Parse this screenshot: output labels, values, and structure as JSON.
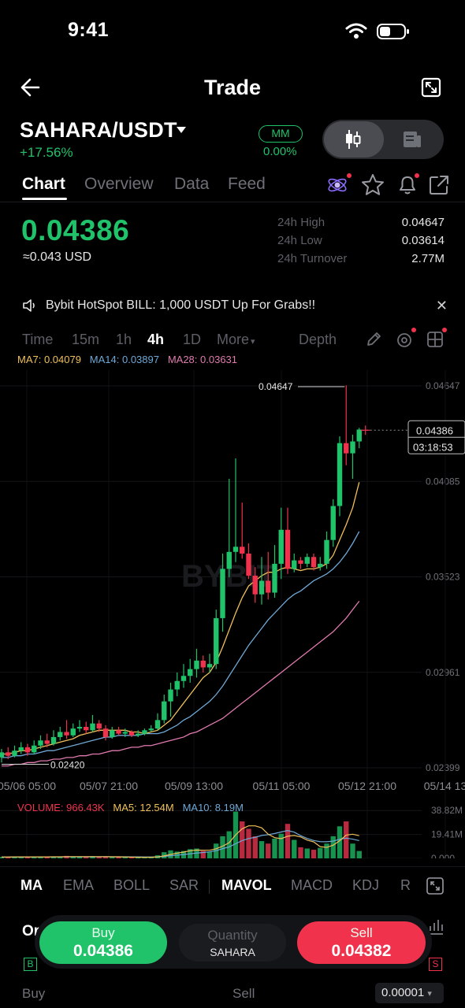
{
  "status_bar": {
    "time": "9:41"
  },
  "header": {
    "title": "Trade"
  },
  "pair": {
    "symbol": "SAHARA/USDT",
    "change": "+17.56%",
    "mm_label": "MM",
    "mm_value": "0.00%"
  },
  "tabs": [
    "Chart",
    "Overview",
    "Data",
    "Feed"
  ],
  "ticker": {
    "last_price": "0.04386",
    "usd_value": "≈0.043 USD",
    "stats": [
      {
        "label": "24h High",
        "value": "0.04647"
      },
      {
        "label": "24h Low",
        "value": "0.03614"
      },
      {
        "label": "24h Turnover",
        "value": "2.77M"
      }
    ]
  },
  "announcement": "Bybit HotSpot BILL: 1,000 USDT Up For Grabs!!",
  "intervals": {
    "items": [
      "Time",
      "15m",
      "1h",
      "4h",
      "1D"
    ],
    "active": "4h",
    "more": "More",
    "depth": "Depth"
  },
  "ma_legend": {
    "ma7": "MA7: 0.04079",
    "ma14": "MA14: 0.03897",
    "ma28": "MA28: 0.03631"
  },
  "colors": {
    "up": "#20c26a",
    "down": "#f0324d",
    "ma7": "#f0c05a",
    "ma14": "#6fa8d6",
    "ma28": "#e07ab0",
    "accent_star": "#9b6cff"
  },
  "chart_data": {
    "type": "candlestick",
    "x_tick_labels": [
      "05/06 05:00",
      "05/07 21:00",
      "05/09 13:00",
      "05/11 05:00",
      "05/12 21:00",
      "05/14 13"
    ],
    "y_tick_labels": [
      "0.04647",
      "0.04085",
      "0.03523",
      "0.02961",
      "0.02399"
    ],
    "ylim": [
      0.02399,
      0.04647
    ],
    "high_marker": "0.04647",
    "low_marker": "0.02420",
    "last_price_tag": "0.04386",
    "countdown": "03:18:53",
    "watermark": "BYBIT",
    "candles": [
      [
        0.0246,
        0.0249,
        0.0243,
        0.0251
      ],
      [
        0.0249,
        0.0247,
        0.0245,
        0.0252
      ],
      [
        0.0247,
        0.025,
        0.0246,
        0.0253
      ],
      [
        0.025,
        0.0252,
        0.0248,
        0.0255
      ],
      [
        0.0252,
        0.0249,
        0.0247,
        0.0254
      ],
      [
        0.0249,
        0.0253,
        0.0248,
        0.0256
      ],
      [
        0.0253,
        0.0256,
        0.0251,
        0.0259
      ],
      [
        0.0256,
        0.0254,
        0.0252,
        0.026
      ],
      [
        0.0254,
        0.0258,
        0.0253,
        0.0262
      ],
      [
        0.0258,
        0.0261,
        0.0256,
        0.0264
      ],
      [
        0.0261,
        0.0259,
        0.0257,
        0.0268
      ],
      [
        0.0259,
        0.0263,
        0.0258,
        0.0266
      ],
      [
        0.0263,
        0.0264,
        0.0261,
        0.0268
      ],
      [
        0.0264,
        0.0262,
        0.026,
        0.0267
      ],
      [
        0.0262,
        0.0266,
        0.0261,
        0.0271
      ],
      [
        0.0266,
        0.0263,
        0.0261,
        0.0268
      ],
      [
        0.0263,
        0.0258,
        0.0256,
        0.0265
      ],
      [
        0.0258,
        0.0262,
        0.0257,
        0.0264
      ],
      [
        0.0262,
        0.026,
        0.0259,
        0.0264
      ],
      [
        0.026,
        0.0261,
        0.0258,
        0.0263
      ],
      [
        0.0261,
        0.0259,
        0.0258,
        0.0262
      ],
      [
        0.0259,
        0.026,
        0.0258,
        0.0262
      ],
      [
        0.026,
        0.0262,
        0.0259,
        0.0263
      ],
      [
        0.0262,
        0.0263,
        0.0261,
        0.0265
      ],
      [
        0.0263,
        0.0268,
        0.0262,
        0.0272
      ],
      [
        0.0268,
        0.0279,
        0.0266,
        0.0283
      ],
      [
        0.0279,
        0.0286,
        0.027,
        0.029
      ],
      [
        0.0286,
        0.0291,
        0.0282,
        0.0296
      ],
      [
        0.0291,
        0.0294,
        0.0287,
        0.0301
      ],
      [
        0.0294,
        0.0298,
        0.029,
        0.0304
      ],
      [
        0.0298,
        0.0303,
        0.0293,
        0.031
      ],
      [
        0.0303,
        0.0299,
        0.0296,
        0.0306
      ],
      [
        0.0299,
        0.0301,
        0.0296,
        0.0307
      ],
      [
        0.0301,
        0.0328,
        0.0298,
        0.0333
      ],
      [
        0.0328,
        0.0357,
        0.032,
        0.0366
      ],
      [
        0.0357,
        0.0367,
        0.0352,
        0.041
      ],
      [
        0.0367,
        0.037,
        0.0361,
        0.0422
      ],
      [
        0.037,
        0.0366,
        0.0363,
        0.0396
      ],
      [
        0.0366,
        0.0353,
        0.0351,
        0.0372
      ],
      [
        0.0353,
        0.0342,
        0.0337,
        0.0358
      ],
      [
        0.0342,
        0.035,
        0.0336,
        0.0364
      ],
      [
        0.035,
        0.0343,
        0.0339,
        0.0367
      ],
      [
        0.0343,
        0.036,
        0.034,
        0.0371
      ],
      [
        0.036,
        0.038,
        0.0351,
        0.0393
      ],
      [
        0.038,
        0.0357,
        0.0354,
        0.0393
      ],
      [
        0.0357,
        0.0362,
        0.0355,
        0.0366
      ],
      [
        0.0362,
        0.036,
        0.0357,
        0.0364
      ],
      [
        0.036,
        0.0364,
        0.0358,
        0.0366
      ],
      [
        0.0364,
        0.0358,
        0.0356,
        0.0366
      ],
      [
        0.0358,
        0.036,
        0.0356,
        0.0364
      ],
      [
        0.036,
        0.0374,
        0.0357,
        0.0379
      ],
      [
        0.0374,
        0.0394,
        0.037,
        0.0398
      ],
      [
        0.0394,
        0.0431,
        0.0388,
        0.0435
      ],
      [
        0.0431,
        0.0425,
        0.0418,
        0.0465
      ],
      [
        0.0425,
        0.0432,
        0.041,
        0.0436
      ],
      [
        0.0432,
        0.0439,
        0.0428,
        0.044
      ]
    ],
    "ma7": [
      0.0248,
      0.0248,
      0.0249,
      0.025,
      0.025,
      0.0251,
      0.0252,
      0.0253,
      0.0254,
      0.0255,
      0.0256,
      0.0257,
      0.0259,
      0.026,
      0.0261,
      0.0262,
      0.0262,
      0.0262,
      0.0262,
      0.0262,
      0.0261,
      0.0261,
      0.026,
      0.0261,
      0.0262,
      0.0265,
      0.0268,
      0.0273,
      0.0278,
      0.0283,
      0.0288,
      0.0293,
      0.0296,
      0.0302,
      0.0311,
      0.0321,
      0.0331,
      0.034,
      0.0347,
      0.035,
      0.0353,
      0.0355,
      0.0355,
      0.0357,
      0.0358,
      0.0357,
      0.0356,
      0.0357,
      0.0357,
      0.0358,
      0.036,
      0.0365,
      0.0374,
      0.0383,
      0.0393,
      0.0408
    ],
    "ma14": [
      0.0246,
      0.0246,
      0.0247,
      0.0247,
      0.0248,
      0.0248,
      0.0249,
      0.025,
      0.025,
      0.0251,
      0.0252,
      0.0253,
      0.0254,
      0.0255,
      0.0256,
      0.0257,
      0.0258,
      0.0258,
      0.0259,
      0.0259,
      0.0259,
      0.0259,
      0.026,
      0.026,
      0.026,
      0.0261,
      0.0263,
      0.0265,
      0.0268,
      0.027,
      0.0273,
      0.0276,
      0.0279,
      0.0283,
      0.0288,
      0.0294,
      0.03,
      0.0306,
      0.0312,
      0.0317,
      0.0322,
      0.0327,
      0.0331,
      0.0335,
      0.0339,
      0.0342,
      0.0344,
      0.0347,
      0.035,
      0.0352,
      0.0354,
      0.0357,
      0.0361,
      0.0366,
      0.0372,
      0.0379
    ],
    "ma28": [
      0.0241,
      0.0241,
      0.0242,
      0.0242,
      0.0243,
      0.0243,
      0.0244,
      0.0244,
      0.0245,
      0.0245,
      0.0246,
      0.0246,
      0.0247,
      0.0247,
      0.0248,
      0.0248,
      0.0249,
      0.025,
      0.025,
      0.0251,
      0.0252,
      0.0252,
      0.0253,
      0.0253,
      0.0254,
      0.0255,
      0.0256,
      0.0257,
      0.0258,
      0.026,
      0.0261,
      0.0263,
      0.0265,
      0.0267,
      0.0269,
      0.0272,
      0.0275,
      0.0278,
      0.0281,
      0.0284,
      0.0287,
      0.029,
      0.0293,
      0.0296,
      0.0299,
      0.0302,
      0.0305,
      0.0308,
      0.0311,
      0.0314,
      0.0317,
      0.032,
      0.0324,
      0.0328,
      0.0333,
      0.0338
    ],
    "volume_ticks": [
      "38.82M",
      "19.41M",
      "0.000"
    ],
    "volume_max": 38.82,
    "volumes": [
      1.2,
      1.0,
      1.5,
      1.1,
      0.9,
      1.3,
      1.4,
      1.0,
      1.6,
      1.2,
      2.0,
      1.1,
      1.0,
      1.3,
      1.8,
      1.5,
      1.2,
      0.9,
      1.0,
      0.8,
      0.7,
      0.8,
      0.9,
      1.0,
      2.5,
      5.0,
      6.5,
      5.5,
      6.0,
      7.5,
      8.0,
      6.0,
      5.5,
      12.0,
      18.0,
      22.0,
      38.0,
      30.0,
      24.0,
      18.0,
      14.0,
      12.0,
      16.0,
      20.0,
      28.0,
      15.0,
      9.0,
      8.0,
      7.0,
      8.5,
      12.0,
      18.0,
      26.0,
      30.0,
      12.0,
      6.0
    ],
    "vol_ma5": [
      1.1,
      1.1,
      1.2,
      1.2,
      1.2,
      1.2,
      1.2,
      1.2,
      1.3,
      1.3,
      1.4,
      1.4,
      1.4,
      1.4,
      1.4,
      1.4,
      1.4,
      1.3,
      1.3,
      1.1,
      1.0,
      0.9,
      0.9,
      0.9,
      1.2,
      2.0,
      3.2,
      4.2,
      5.1,
      6.2,
      6.7,
      6.6,
      6.6,
      7.8,
      9.9,
      12.7,
      19.1,
      24.0,
      26.4,
      26.4,
      24.8,
      19.6,
      16.8,
      16.0,
      18.0,
      18.6,
      17.4,
      14.8,
      13.4,
      9.5,
      8.9,
      10.7,
      14.3,
      18.9,
      19.6,
      18.4
    ],
    "vol_ma10": [
      1.0,
      1.0,
      1.1,
      1.1,
      1.1,
      1.2,
      1.2,
      1.2,
      1.2,
      1.2,
      1.3,
      1.3,
      1.3,
      1.3,
      1.3,
      1.3,
      1.4,
      1.3,
      1.3,
      1.3,
      1.2,
      1.2,
      1.1,
      1.1,
      1.2,
      1.6,
      2.1,
      2.6,
      3.1,
      3.7,
      4.3,
      4.8,
      5.3,
      6.3,
      7.9,
      9.3,
      11.9,
      14.4,
      16.1,
      17.1,
      18.6,
      19.2,
      20.2,
      21.4,
      22.6,
      21.3,
      18.4,
      16.2,
      14.5,
      13.6,
      13.5,
      14.0,
      15.5,
      16.4,
      15.6,
      14.4
    ]
  },
  "volume_legend": {
    "volume": "VOLUME: 966.43K",
    "ma5": "MA5: 12.54M",
    "ma10": "MA10: 8.19M"
  },
  "indicators": [
    "MA",
    "EMA",
    "BOLL",
    "SAR",
    "MAVOL",
    "MACD",
    "KDJ",
    "R"
  ],
  "trade_bar": {
    "buy_label": "Buy",
    "buy_price": "0.04386",
    "qty_placeholder": "Quantity",
    "qty_unit": "SAHARA",
    "sell_label": "Sell",
    "sell_price": "0.04382"
  },
  "orderbook": {
    "tab_label": "Or",
    "b_badge": "B",
    "s_badge": "S",
    "buy_header": "Buy",
    "sell_header": "Sell",
    "precision": "0.00001"
  }
}
